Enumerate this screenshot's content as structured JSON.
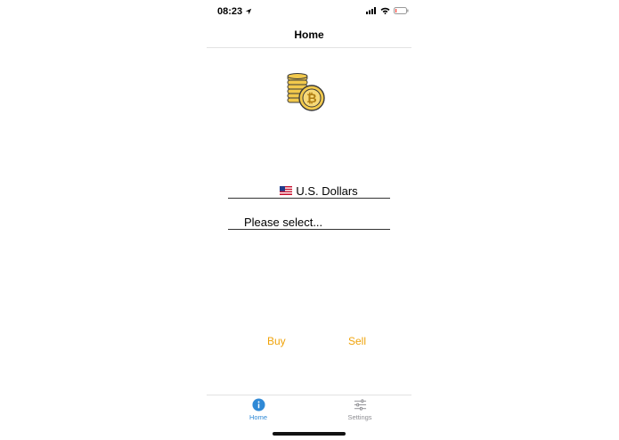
{
  "status_bar": {
    "time": "08:23",
    "icons": [
      "location-arrow-icon",
      "cellular-signal-icon",
      "wifi-icon",
      "battery-icon"
    ]
  },
  "nav": {
    "title": "Home"
  },
  "main": {
    "coin_image": "bitcoin-coins-icon",
    "currency_field": {
      "flag": "us-flag-icon",
      "value": "U.S. Dollars"
    },
    "crypto_select": {
      "placeholder": "Please select..."
    },
    "buy_label": "Buy",
    "sell_label": "Sell",
    "accent_color": "#f0a30a"
  },
  "tab_bar": {
    "active_color": "#2f89d6",
    "inactive_color": "#8e8e93",
    "tabs": [
      {
        "label": "Home",
        "icon": "info-circle-icon",
        "active": true
      },
      {
        "label": "Settings",
        "icon": "sliders-icon",
        "active": false
      }
    ]
  }
}
